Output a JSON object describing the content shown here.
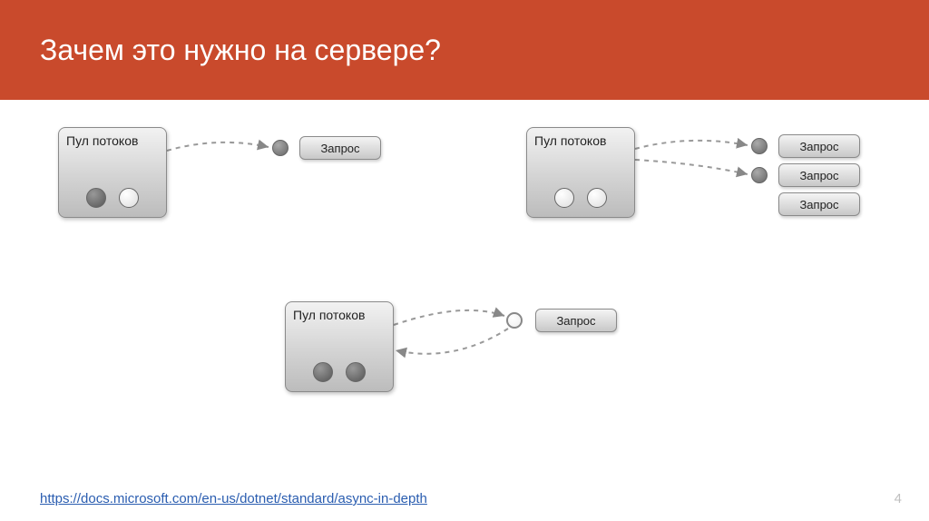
{
  "header": {
    "title": "Зачем это нужно на сервере?"
  },
  "diagram": {
    "pool_label": "Пул потоков",
    "request_label": "Запрос"
  },
  "footer": {
    "link_text": "https://docs.microsoft.com/en-us/dotnet/standard/async-in-depth",
    "page_number": "4"
  }
}
